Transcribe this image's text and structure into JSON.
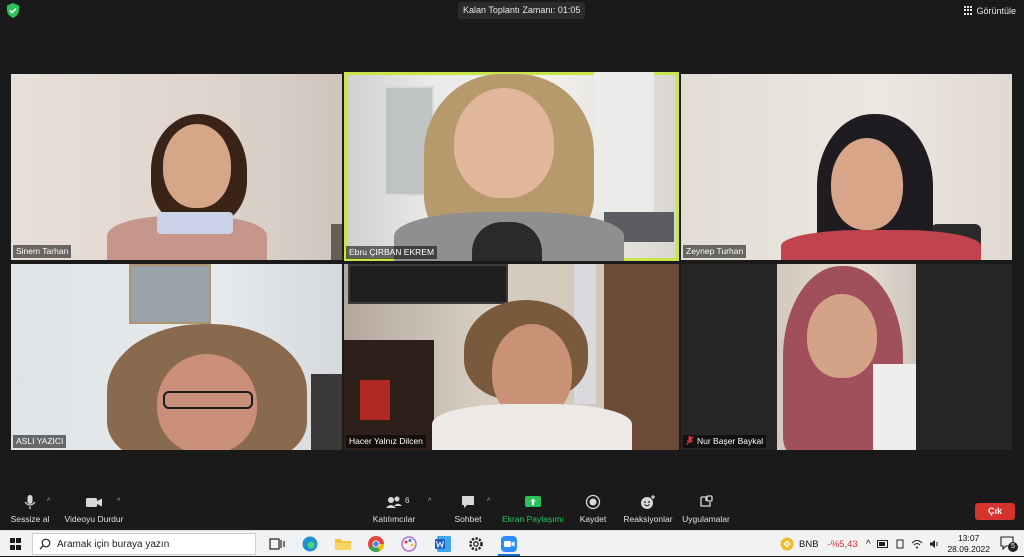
{
  "meeting": {
    "timer_label": "Kalan Toplantı Zamanı: 01:05",
    "view_label": "Görüntüle"
  },
  "participants": [
    {
      "name": "Sinem Tarhan",
      "muted": false
    },
    {
      "name": "Ebru ÇIRBAN EKREM",
      "muted": false,
      "active_speaker": true
    },
    {
      "name": "Zeynep Turhan",
      "muted": false
    },
    {
      "name": "ASLI YAZICI",
      "muted": false
    },
    {
      "name": "Hacer Yalnız Dilcen",
      "muted": false
    },
    {
      "name": "Nur Başer Baykal",
      "muted": true
    }
  ],
  "toolbar": {
    "mute_label": "Sessize al",
    "video_label": "Videoyu Durdur",
    "participants_label": "Katılımcılar",
    "participants_count": "6",
    "chat_label": "Sohbet",
    "share_label": "Ekran Paylaşımı",
    "record_label": "Kaydet",
    "reactions_label": "Reaksiyonlar",
    "apps_label": "Uygulamalar",
    "leave_label": "Çık"
  },
  "taskbar": {
    "search_placeholder": "Aramak için buraya yazın",
    "crypto_symbol": "BNB",
    "crypto_change": "-%5,43",
    "time": "13:07",
    "date": "28.09.2022",
    "notification_count": "5"
  },
  "colors": {
    "active_speaker_border": "#c8e64b",
    "share_green": "#29c35a",
    "leave_red": "#d6322e",
    "crypto_red": "#d13438"
  }
}
